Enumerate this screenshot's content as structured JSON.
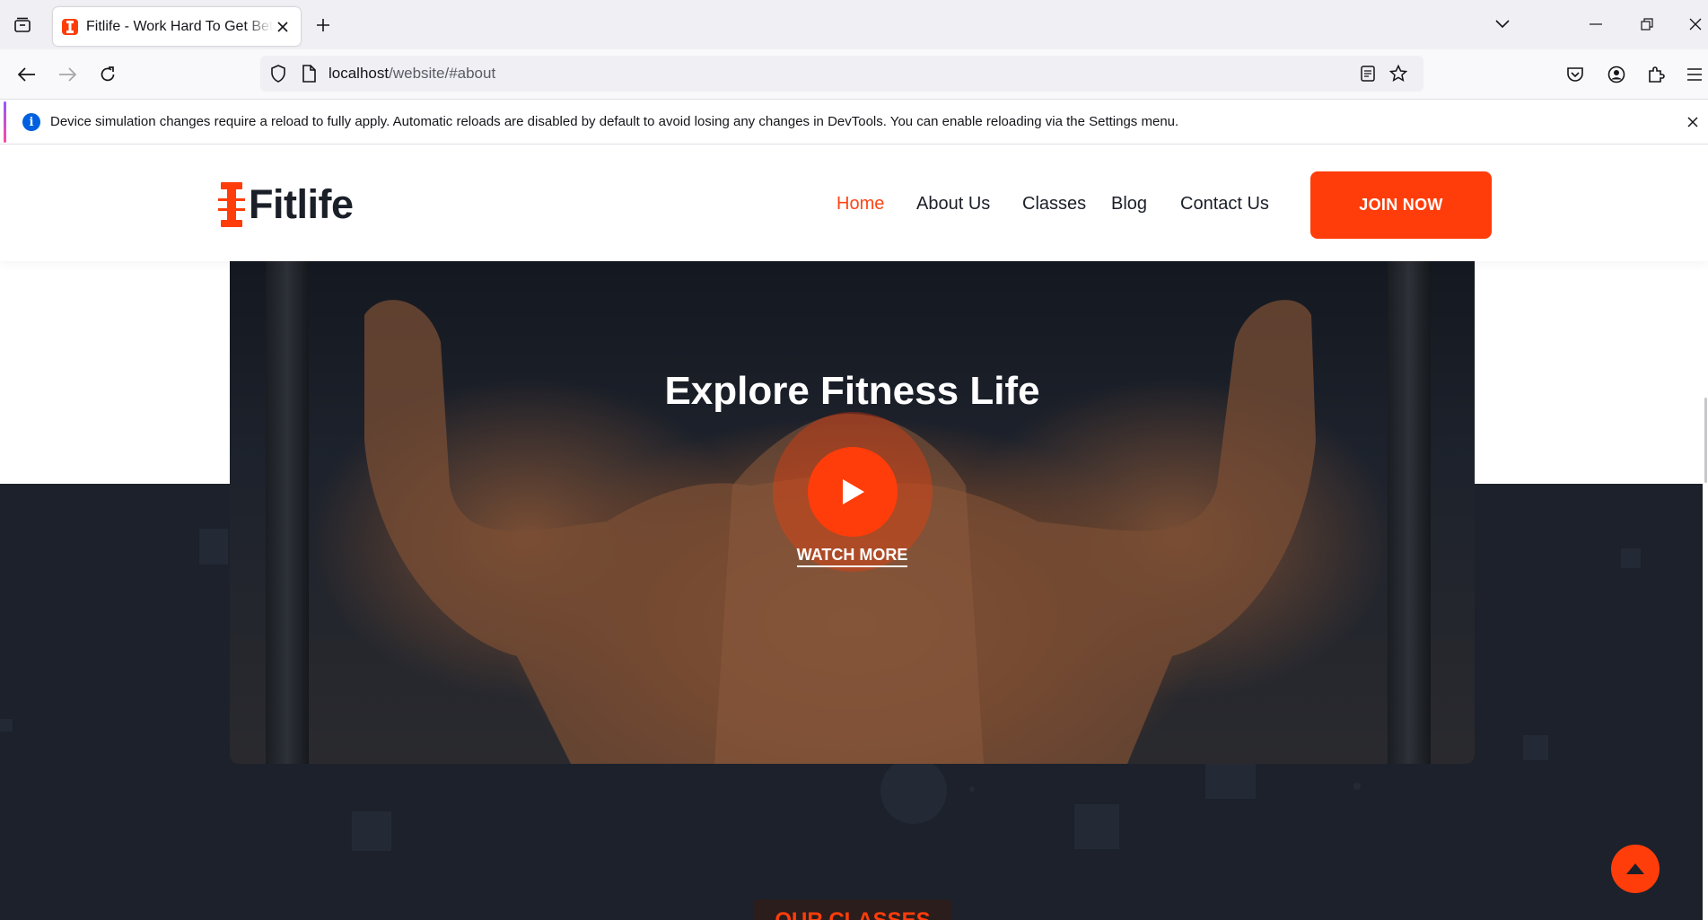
{
  "browser": {
    "tab_title": "Fitlife - Work Hard To Get Better Life",
    "url_host": "localhost",
    "url_path": "/website/#about",
    "notice_text": "Device simulation changes require a reload to fully apply. Automatic reloads are disabled by default to avoid losing any changes in DevTools. You can enable reloading via the Settings menu.",
    "icons": [
      "tab-list-icon",
      "close-icon",
      "plus-icon",
      "chevron-down-icon",
      "minimize-icon",
      "restore-icon",
      "back-icon",
      "forward-icon",
      "reload-icon",
      "shield-icon",
      "page-icon",
      "reader-icon",
      "star-icon",
      "pocket-icon",
      "account-icon",
      "extensions-icon",
      "menu-icon",
      "info-icon"
    ]
  },
  "site": {
    "logo_text": "Fitlife",
    "menu": [
      {
        "label": "Home",
        "active": true
      },
      {
        "label": "About Us",
        "active": false
      },
      {
        "label": "Classes",
        "active": false
      },
      {
        "label": "Blog",
        "active": false
      },
      {
        "label": "Contact Us",
        "active": false
      }
    ],
    "join_label": "JOIN NOW",
    "hero": {
      "title": "Explore Fitness Life",
      "watch_label": "WATCH MORE"
    },
    "classes_tag": "OUR CLASSES",
    "colors": {
      "accent": "#ff3d0a",
      "dark": "#1c212b",
      "text": "#1b1f28"
    }
  }
}
